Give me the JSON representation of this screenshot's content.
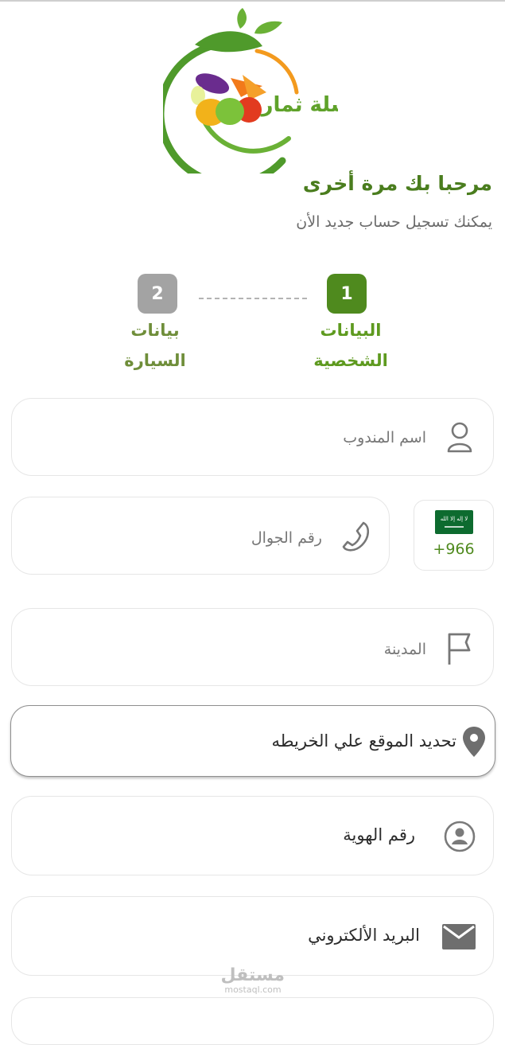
{
  "brand": {
    "logo_text": "سلة ثمار"
  },
  "welcome": {
    "title": "مرحبا بك مرة أخرى",
    "subtitle": "يمكنك تسجيل حساب جديد الأن"
  },
  "steps": [
    {
      "number": "1",
      "label_line1": "البيانات",
      "label_line2": "الشخصية",
      "active": true
    },
    {
      "number": "2",
      "label_line1": "بيانات",
      "label_line2": "السيارة",
      "active": false
    }
  ],
  "form": {
    "agent_name": {
      "placeholder": "اسم المندوب",
      "icon": "user-icon"
    },
    "phone": {
      "placeholder": "رقم الجوال",
      "icon": "phone-icon"
    },
    "country_code": {
      "value": "+966",
      "icon": "saudi-flag-icon"
    },
    "city": {
      "placeholder": "المدينة",
      "icon": "flag-icon"
    },
    "location": {
      "label": "تحديد الموقع علي الخريطه",
      "icon": "map-pin-icon"
    },
    "national_id": {
      "placeholder": "رقم الهوية",
      "icon": "id-badge-icon"
    },
    "email": {
      "placeholder": "البريد الألكتروني",
      "icon": "envelope-icon"
    }
  },
  "watermark": {
    "arabic": "مستقل",
    "latin": "mostaql.com"
  },
  "colors": {
    "primary": "#4f8a1e",
    "inactive": "#a3a3a3",
    "border": "#e6e6e6"
  }
}
